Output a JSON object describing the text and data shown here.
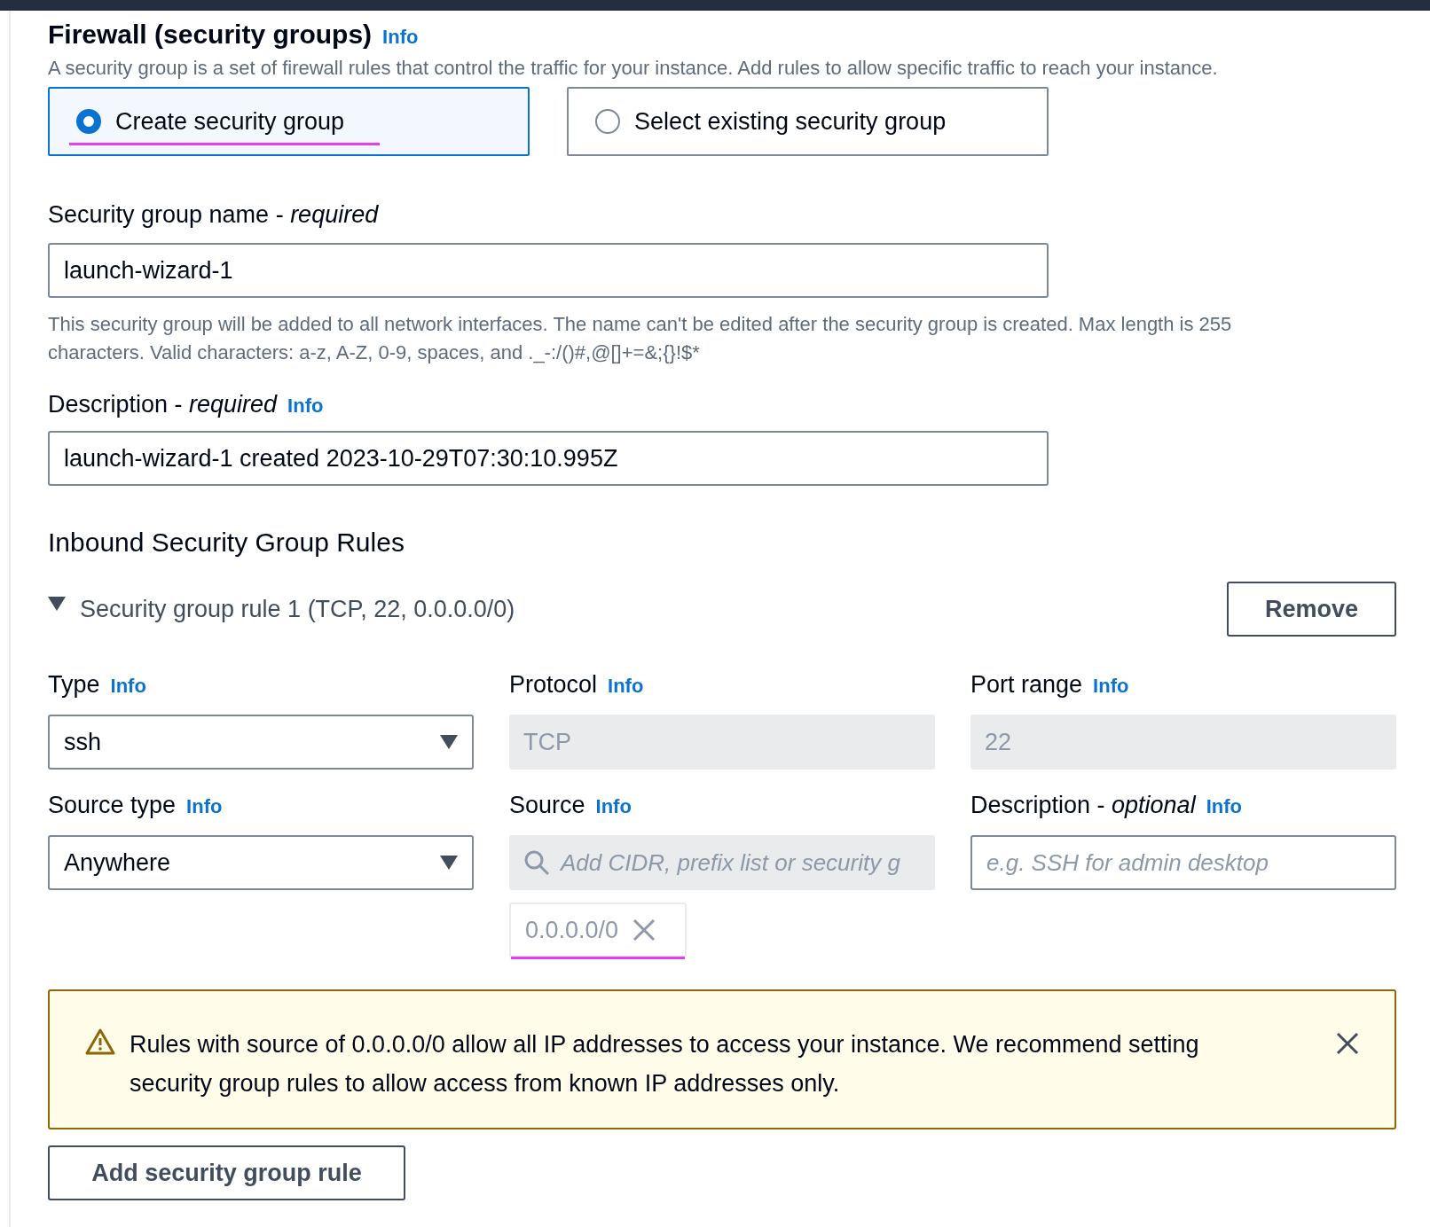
{
  "section": {
    "title": "Firewall (security groups)",
    "info_link": "Info",
    "description": "A security group is a set of firewall rules that control the traffic for your instance. Add rules to allow specific traffic to reach your instance."
  },
  "options": [
    {
      "label": "Create security group",
      "selected": true
    },
    {
      "label": "Select existing security group",
      "selected": false
    }
  ],
  "name_field": {
    "label": "Security group name - *required*",
    "value": "launch-wizard-1",
    "helper": "This security group will be added to all network interfaces. The name can't be edited after the security group is created. Max length is 255 characters. Valid characters: a-z, A-Z, 0-9, spaces, and ._-:/()#,@[]+=&;{}!$*"
  },
  "description_field": {
    "label": "Description - *required*",
    "info_link": "Info",
    "value": "launch-wizard-1 created 2023-10-29T07:30:10.995Z"
  },
  "inbound": {
    "heading": "Inbound Security Group Rules",
    "rule": {
      "title": "Security group rule 1 (TCP, 22, 0.0.0.0/0)",
      "expanded": true,
      "remove_button": "Remove",
      "fields": [
        {
          "kind": "select",
          "label": "Type",
          "info_link": "Info",
          "value": "ssh"
        },
        {
          "kind": "readonly",
          "label": "Protocol",
          "info_link": "Info",
          "value": "TCP"
        },
        {
          "kind": "readonly",
          "label": "Port range",
          "info_link": "Info",
          "value": "22"
        },
        {
          "kind": "select",
          "label": "Source type",
          "info_link": "Info",
          "value": "Anywhere"
        },
        {
          "kind": "search",
          "label": "Source",
          "info_link": "Info",
          "placeholder": "Add CIDR, prefix list or security g"
        },
        {
          "kind": "text",
          "label": "Description - *optional*",
          "info_link": "Info",
          "placeholder": "e.g. SSH for admin desktop"
        }
      ],
      "source_chip": "0.0.0.0/0"
    }
  },
  "alert": {
    "text": "Rules with source of 0.0.0.0/0 allow all IP addresses to access your instance. We recommend setting security group rules to allow access from known IP addresses only."
  },
  "add_button": "Add security group rule"
}
